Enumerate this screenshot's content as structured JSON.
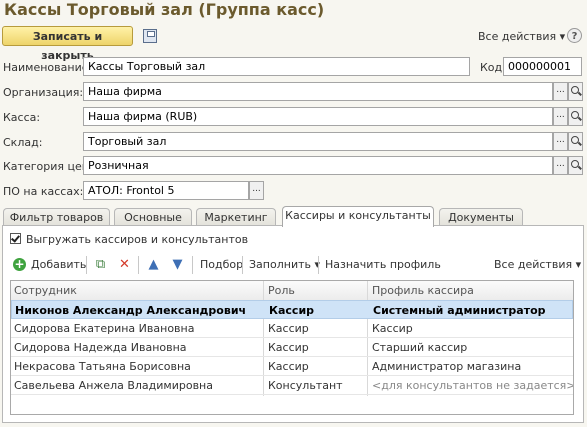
{
  "title": "Кассы Торговый зал (Группа касс)",
  "toolbar": {
    "save_close": "Записать и закрыть",
    "all_actions": "Все действия ▾",
    "help": "?"
  },
  "form": {
    "name_label": "Наименование:",
    "name_value": "Кассы Торговый зал",
    "code_label": "Код:",
    "code_value": "000000001",
    "org_label": "Организация:",
    "org_value": "Наша фирма",
    "kassa_label": "Касса:",
    "kassa_value": "Наша фирма (RUB)",
    "sklad_label": "Склад:",
    "sklad_value": "Торговый зал",
    "price_label": "Категория цен:",
    "price_value": "Розничная",
    "po_label": "ПО на кассах:",
    "po_value": "АТОЛ: Frontol 5",
    "dots": "..."
  },
  "tabs": [
    "Фильтр товаров",
    "Основные",
    "Маркетинг",
    "Кассиры и консультанты",
    "Документы"
  ],
  "panel": {
    "checkbox_label": "Выгружать кассиров и консультантов",
    "add": "Добавить",
    "podbor": "Подбор",
    "fill": "Заполнить ▾",
    "assign": "Назначить профиль",
    "all_actions": "Все действия ▾"
  },
  "table": {
    "headers": [
      "Сотрудник",
      "Роль",
      "Профиль кассира"
    ],
    "rows": [
      [
        "Никонов Александр Александрович",
        "Кассир",
        "Системный администратор"
      ],
      [
        "Сидорова Екатерина Ивановна",
        "Кассир",
        "Кассир"
      ],
      [
        "Сидорова Надежда Ивановна",
        "Кассир",
        "Старший кассир"
      ],
      [
        "Некрасова Татьяна Борисовна",
        "Кассир",
        "Администратор магазина"
      ],
      [
        "Савельева Анжела Владимировна",
        "Консультант",
        "<для консультантов не задается>"
      ]
    ]
  },
  "colors": {
    "accent": "#6b5a2d",
    "selection": "#cfe3f7"
  },
  "icons": [
    "save-icon",
    "help-icon",
    "ellipsis-icon",
    "search-icon",
    "add-icon",
    "copy-icon",
    "delete-icon",
    "move-up-icon",
    "move-down-icon"
  ]
}
